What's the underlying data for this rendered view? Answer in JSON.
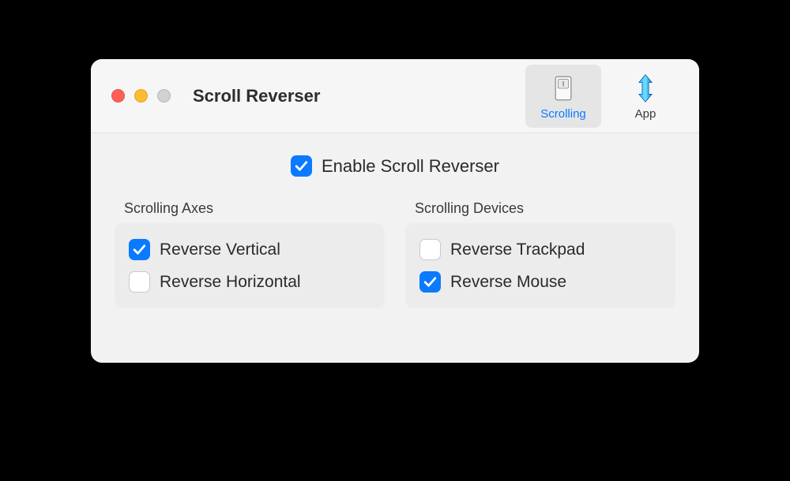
{
  "window": {
    "title": "Scroll Reverser"
  },
  "tabs": {
    "scrolling": {
      "label": "Scrolling"
    },
    "app": {
      "label": "App"
    }
  },
  "main": {
    "enable_label": "Enable Scroll Reverser",
    "enable_checked": true
  },
  "axes": {
    "title": "Scrolling Axes",
    "reverse_vertical": {
      "label": "Reverse Vertical",
      "checked": true
    },
    "reverse_horizontal": {
      "label": "Reverse Horizontal",
      "checked": false
    }
  },
  "devices": {
    "title": "Scrolling Devices",
    "reverse_trackpad": {
      "label": "Reverse Trackpad",
      "checked": false
    },
    "reverse_mouse": {
      "label": "Reverse Mouse",
      "checked": true
    }
  },
  "colors": {
    "accent": "#0a7aff"
  }
}
